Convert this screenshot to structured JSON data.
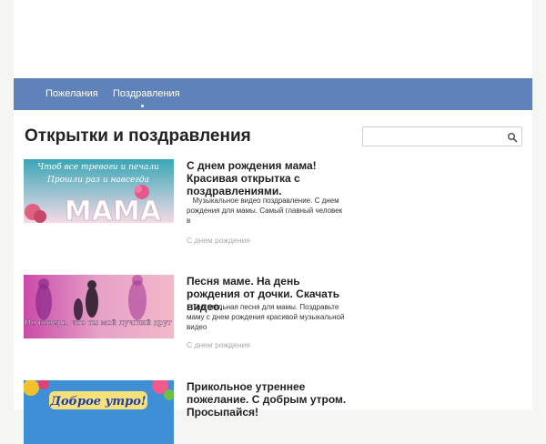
{
  "nav": {
    "items": [
      {
        "label": "Пожелания"
      },
      {
        "label": "Поздравления"
      }
    ]
  },
  "main": {
    "page_title": "Открытки и поздравления"
  },
  "search": {
    "placeholder": "",
    "value": "",
    "icon": "search-icon"
  },
  "posts": [
    {
      "title": "С днем рождения мама! Красивая открытка с поздравлениями.",
      "excerpt": "Музыкальное видео поздравление. С днем рождения для мамы. Самый главный человек в",
      "category": "С днем рождения",
      "thumb_text_top": "Чтоб все тревоги и печали",
      "thumb_text_mid": "Прошли раз и навсегда",
      "thumb_text_big": "МАМА"
    },
    {
      "title": "Песня маме. На день рождения от дочки. Скачать видео.",
      "excerpt": "Трогательная песня для мамы. Поздравьте маму с днем рождения красивой музыкальной видео",
      "category": "С днем рождения",
      "thumb_caption": "Но поверь, что ты мой лучший друг"
    },
    {
      "title": "Прикольное утреннее пожелание. С добрым утром. Просыпайся!",
      "thumb_caption": "Доброе утро!"
    }
  ],
  "colors": {
    "navbar": "#5e82b9",
    "background": "#f5f5f3"
  }
}
